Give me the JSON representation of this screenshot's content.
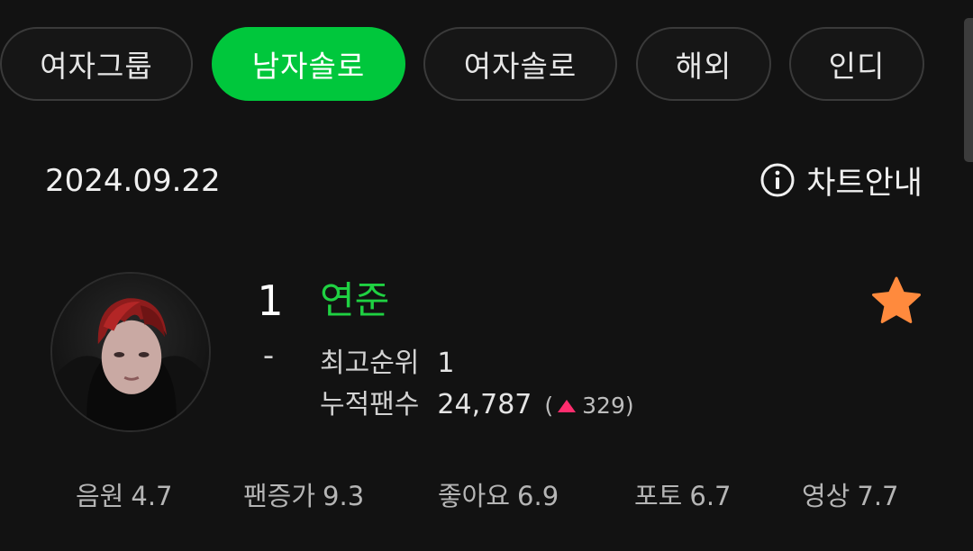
{
  "tabs": [
    {
      "label": "여자그룹",
      "active": false
    },
    {
      "label": "남자솔로",
      "active": true
    },
    {
      "label": "여자솔로",
      "active": false
    },
    {
      "label": "해외",
      "active": false
    },
    {
      "label": "인디",
      "active": false
    }
  ],
  "date": "2024.09.22",
  "chart_guide": {
    "label": "차트안내",
    "icon": "info-icon"
  },
  "entry": {
    "rank": "1",
    "rank_change": "-",
    "artist": "연준",
    "favorite_icon": "star-icon",
    "best_rank_label": "최고순위",
    "best_rank_value": "1",
    "fans_label": "누적팬수",
    "fans_value": "24,787",
    "fans_delta_open": "(",
    "fans_delta": "329",
    "fans_delta_close": ")"
  },
  "scores": [
    {
      "label": "음원",
      "value": "4.7"
    },
    {
      "label": "팬증가",
      "value": "9.3"
    },
    {
      "label": "좋아요",
      "value": "6.9"
    },
    {
      "label": "포토",
      "value": "6.7"
    },
    {
      "label": "영상",
      "value": "7.7"
    }
  ],
  "colors": {
    "background": "#121212",
    "accent_green": "#00c73c",
    "artist_green": "#1fd142",
    "star_orange": "#ff8a3d",
    "up_arrow": "#ff2d6e"
  }
}
